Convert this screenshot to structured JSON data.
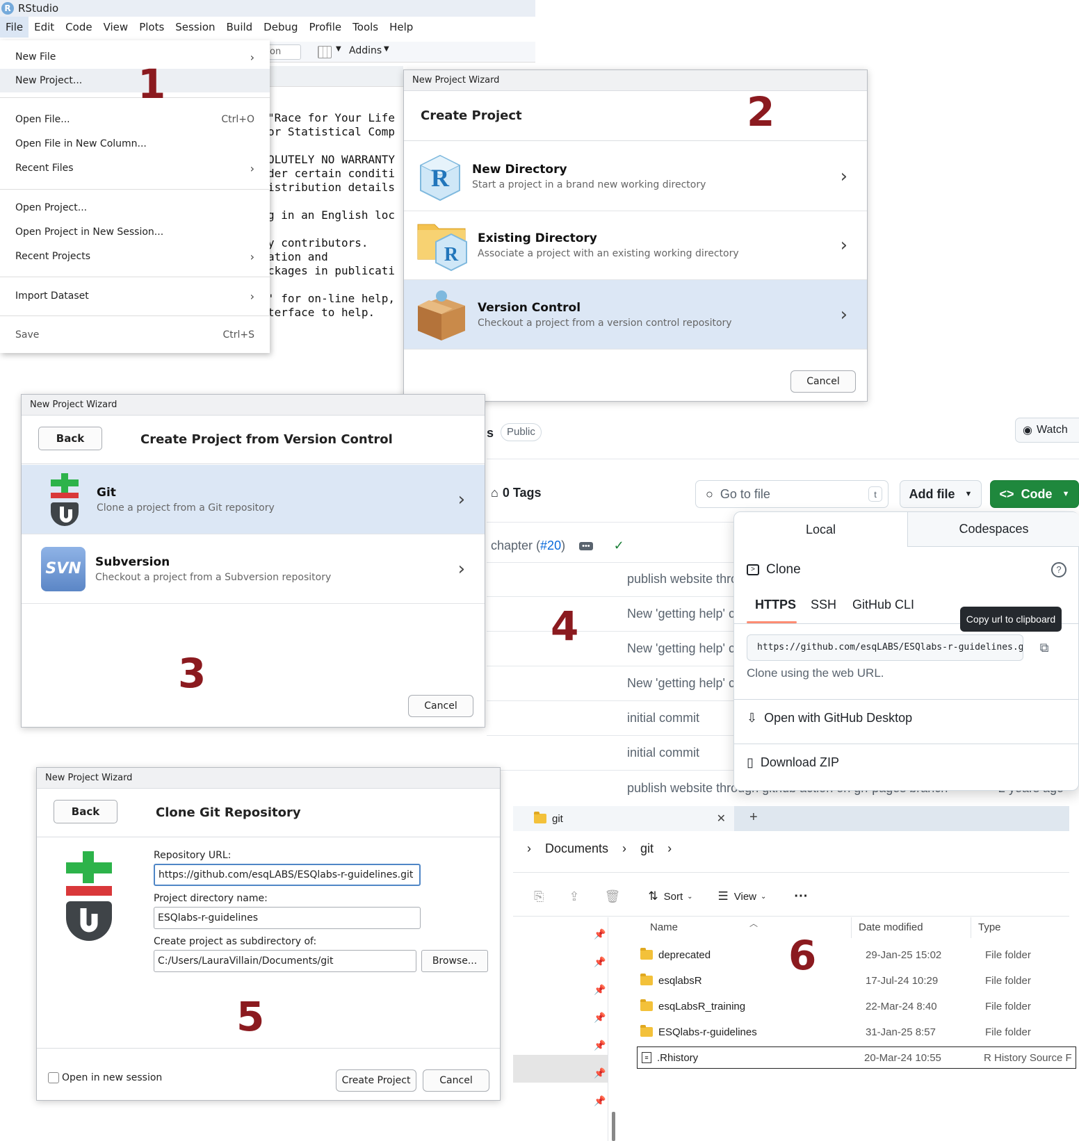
{
  "rstudio": {
    "title": "RStudio",
    "menu": [
      "File",
      "Edit",
      "Code",
      "View",
      "Plots",
      "Session",
      "Build",
      "Debug",
      "Profile",
      "Tools",
      "Help"
    ],
    "toolbar_fragment": "on",
    "addins": "Addins",
    "console_lines": [
      "\"Race for Your Life",
      "or Statistical Comp",
      "",
      "OLUTELY NO WARRANTY",
      "der certain conditi",
      "istribution details",
      "",
      "g in an English loc",
      "",
      "y contributors.",
      "ation and",
      "ckages in publicati",
      "",
      "' for on-line help,",
      "terface to help."
    ],
    "file_menu": {
      "new_file": "New File",
      "new_project": "New Project...",
      "open_file": "Open File...",
      "open_file_shortcut": "Ctrl+O",
      "open_file_new_column": "Open File in New Column...",
      "recent_files": "Recent Files",
      "open_project": "Open Project...",
      "open_project_new_session": "Open Project in New Session...",
      "recent_projects": "Recent Projects",
      "import_dataset": "Import Dataset",
      "save": "Save",
      "save_shortcut": "Ctrl+S"
    }
  },
  "step_numbers": [
    "1",
    "2",
    "3",
    "4",
    "5",
    "6"
  ],
  "wizard_create": {
    "title": "New Project Wizard",
    "heading": "Create Project",
    "options": [
      {
        "title": "New Directory",
        "subtitle": "Start a project in a brand new working directory"
      },
      {
        "title": "Existing Directory",
        "subtitle": "Associate a project with an existing working directory"
      },
      {
        "title": "Version Control",
        "subtitle": "Checkout a project from a version control repository"
      }
    ],
    "cancel": "Cancel"
  },
  "wizard_vc": {
    "title": "New Project Wizard",
    "back": "Back",
    "heading": "Create Project from Version Control",
    "options": [
      {
        "title": "Git",
        "subtitle": "Clone a project from a Git repository"
      },
      {
        "title": "Subversion",
        "subtitle": "Checkout a project from a Subversion repository"
      }
    ],
    "svn_label": "SVN",
    "cancel": "Cancel"
  },
  "wizard_clone": {
    "title": "New Project Wizard",
    "back": "Back",
    "heading": "Clone Git Repository",
    "repo_url_label": "Repository URL:",
    "repo_url_value": "https://github.com/esqLABS/ESQlabs-r-guidelines.git",
    "dir_name_label": "Project directory name:",
    "dir_name_value": "ESQlabs-r-guidelines",
    "subdir_label": "Create project as subdirectory of:",
    "subdir_value": "C:/Users/LauraVillain/Documents/git",
    "browse": "Browse...",
    "open_new_session": "Open in new session",
    "create_project": "Create Project",
    "cancel": "Cancel"
  },
  "github": {
    "repo_suffix": "s",
    "visibility": "Public",
    "watch": "Watch",
    "tags": "0 Tags",
    "go_to_file": "Go to file",
    "go_to_file_key": "t",
    "add_file": "Add file",
    "code": "Code",
    "latest_commit_prefix": "chapter (",
    "latest_commit_pr": "#20",
    "latest_commit_suffix": ")",
    "commits": [
      "publish website thro",
      "New 'getting help' c",
      "New 'getting help' c",
      "New 'getting help' c",
      "initial commit",
      "initial commit",
      "publish website through github action on gh-pages branch"
    ],
    "last_commit_age": "2 years ago",
    "clone_panel": {
      "tab_local": "Local",
      "tab_codespaces": "Codespaces",
      "clone_label": "Clone",
      "protocols": [
        "HTTPS",
        "SSH",
        "GitHub CLI"
      ],
      "url": "https://github.com/esqLABS/ESQlabs-r-guidelines.git",
      "tooltip": "Copy url to clipboard",
      "hint": "Clone using the web URL.",
      "open_desktop": "Open with GitHub Desktop",
      "download_zip": "Download ZIP"
    }
  },
  "explorer": {
    "tab_title": "git",
    "breadcrumb": [
      "Documents",
      "git"
    ],
    "toolbar": {
      "sort": "Sort",
      "view": "View"
    },
    "columns": [
      "Name",
      "Date modified",
      "Type"
    ],
    "rows": [
      {
        "name": "deprecated",
        "date": "29-Jan-25 15:02",
        "type": "File folder"
      },
      {
        "name": "esqlabsR",
        "date": "17-Jul-24 10:29",
        "type": "File folder"
      },
      {
        "name": "esqLabsR_training",
        "date": "22-Mar-24 8:40",
        "type": "File folder"
      },
      {
        "name": "ESQlabs-r-guidelines",
        "date": "31-Jan-25 8:57",
        "type": "File folder"
      },
      {
        "name": ".Rhistory",
        "date": "20-Mar-24 10:55",
        "type": "R History Source F"
      }
    ]
  },
  "colors": {
    "step_number": "#8b1a1f",
    "selected_row": "#dce7f5",
    "github_green": "#1f883d",
    "github_tab_underline": "#fd8c73",
    "folder_yellow": "#f3c13a"
  }
}
